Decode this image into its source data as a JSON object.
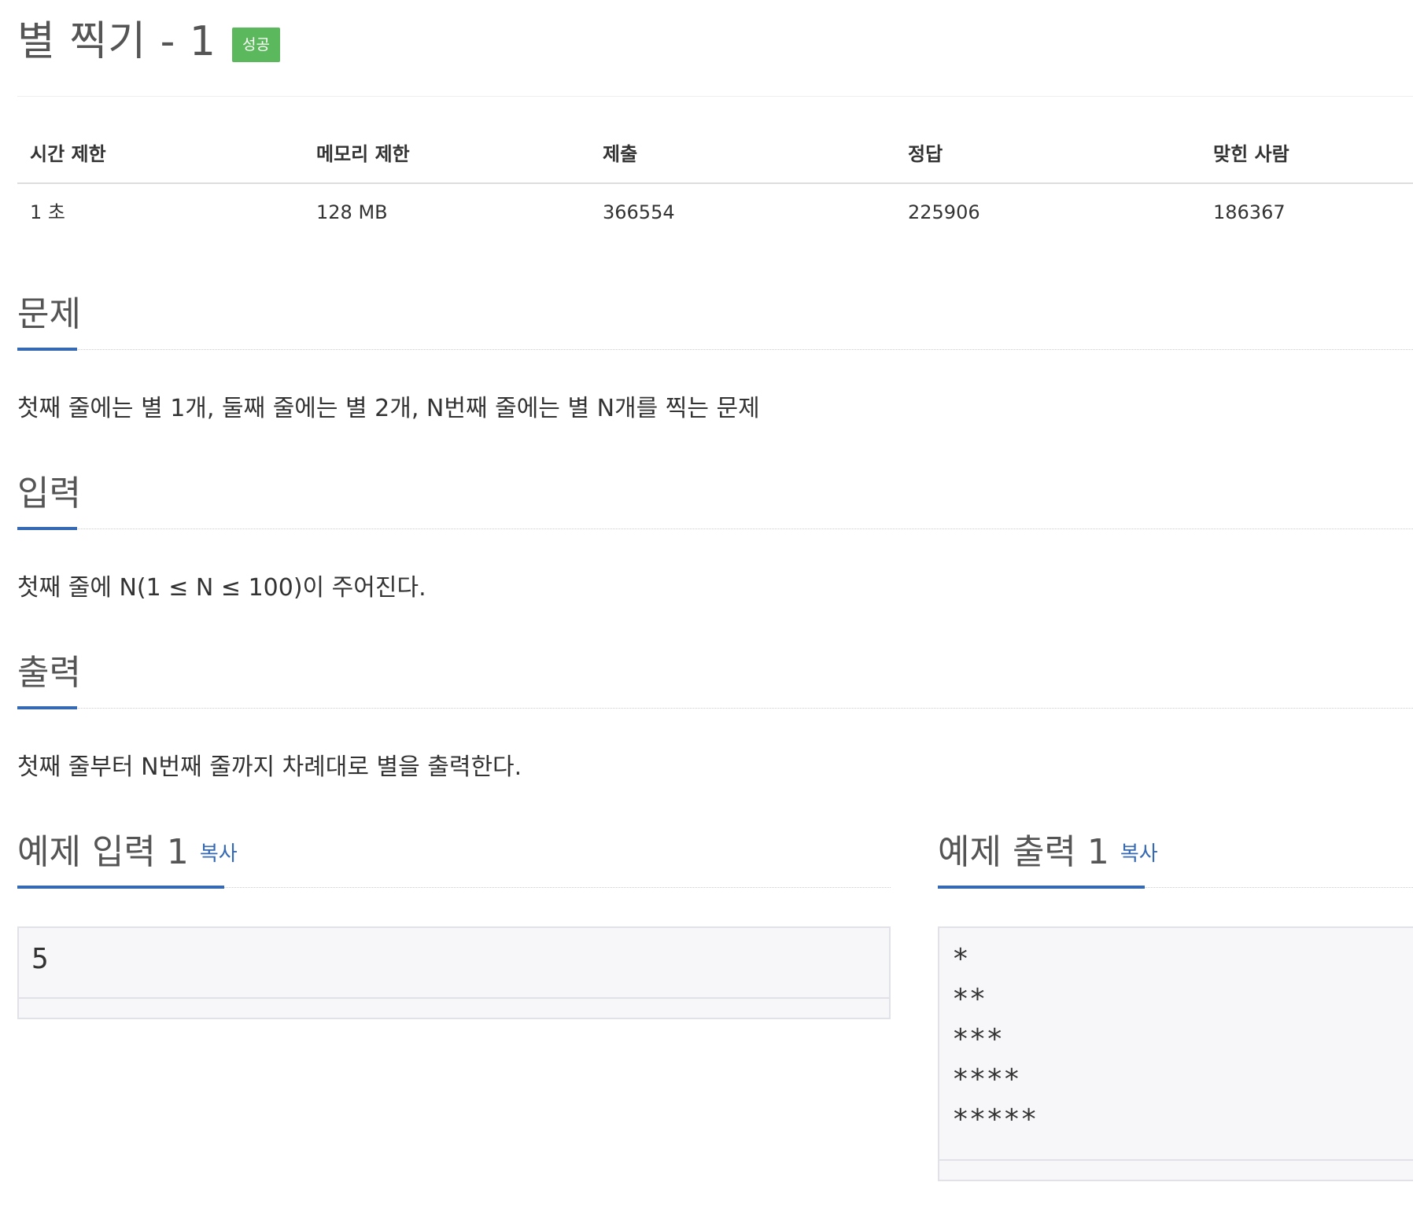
{
  "problem": {
    "title": "별 찍기 - 1",
    "status": "성공"
  },
  "info_table": {
    "headers": [
      "시간 제한",
      "메모리 제한",
      "제출",
      "정답",
      "맞힌 사람"
    ],
    "values": [
      "1 초",
      "128 MB",
      "366554",
      "225906",
      "186367"
    ]
  },
  "sections": {
    "description": {
      "heading": "문제",
      "text": "첫째 줄에는 별 1개, 둘째 줄에는 별 2개, N번째 줄에는 별 N개를 찍는 문제"
    },
    "input": {
      "heading": "입력",
      "text": "첫째 줄에 N(1 ≤ N ≤ 100)이 주어진다."
    },
    "output": {
      "heading": "출력",
      "text": "첫째 줄부터 N번째 줄까지 차례대로 별을 출력한다."
    }
  },
  "samples": {
    "input": {
      "heading": "예제 입력 1",
      "copy_label": "복사",
      "content": "5"
    },
    "output": {
      "heading": "예제 출력 1",
      "copy_label": "복사",
      "content": "*\n**\n***\n****\n*****"
    }
  },
  "colors": {
    "accent": "#3669b3",
    "success": "#5cb85c",
    "heading_text": "#555555",
    "body_text": "#333333",
    "sample_bg": "#f7f7f9"
  }
}
